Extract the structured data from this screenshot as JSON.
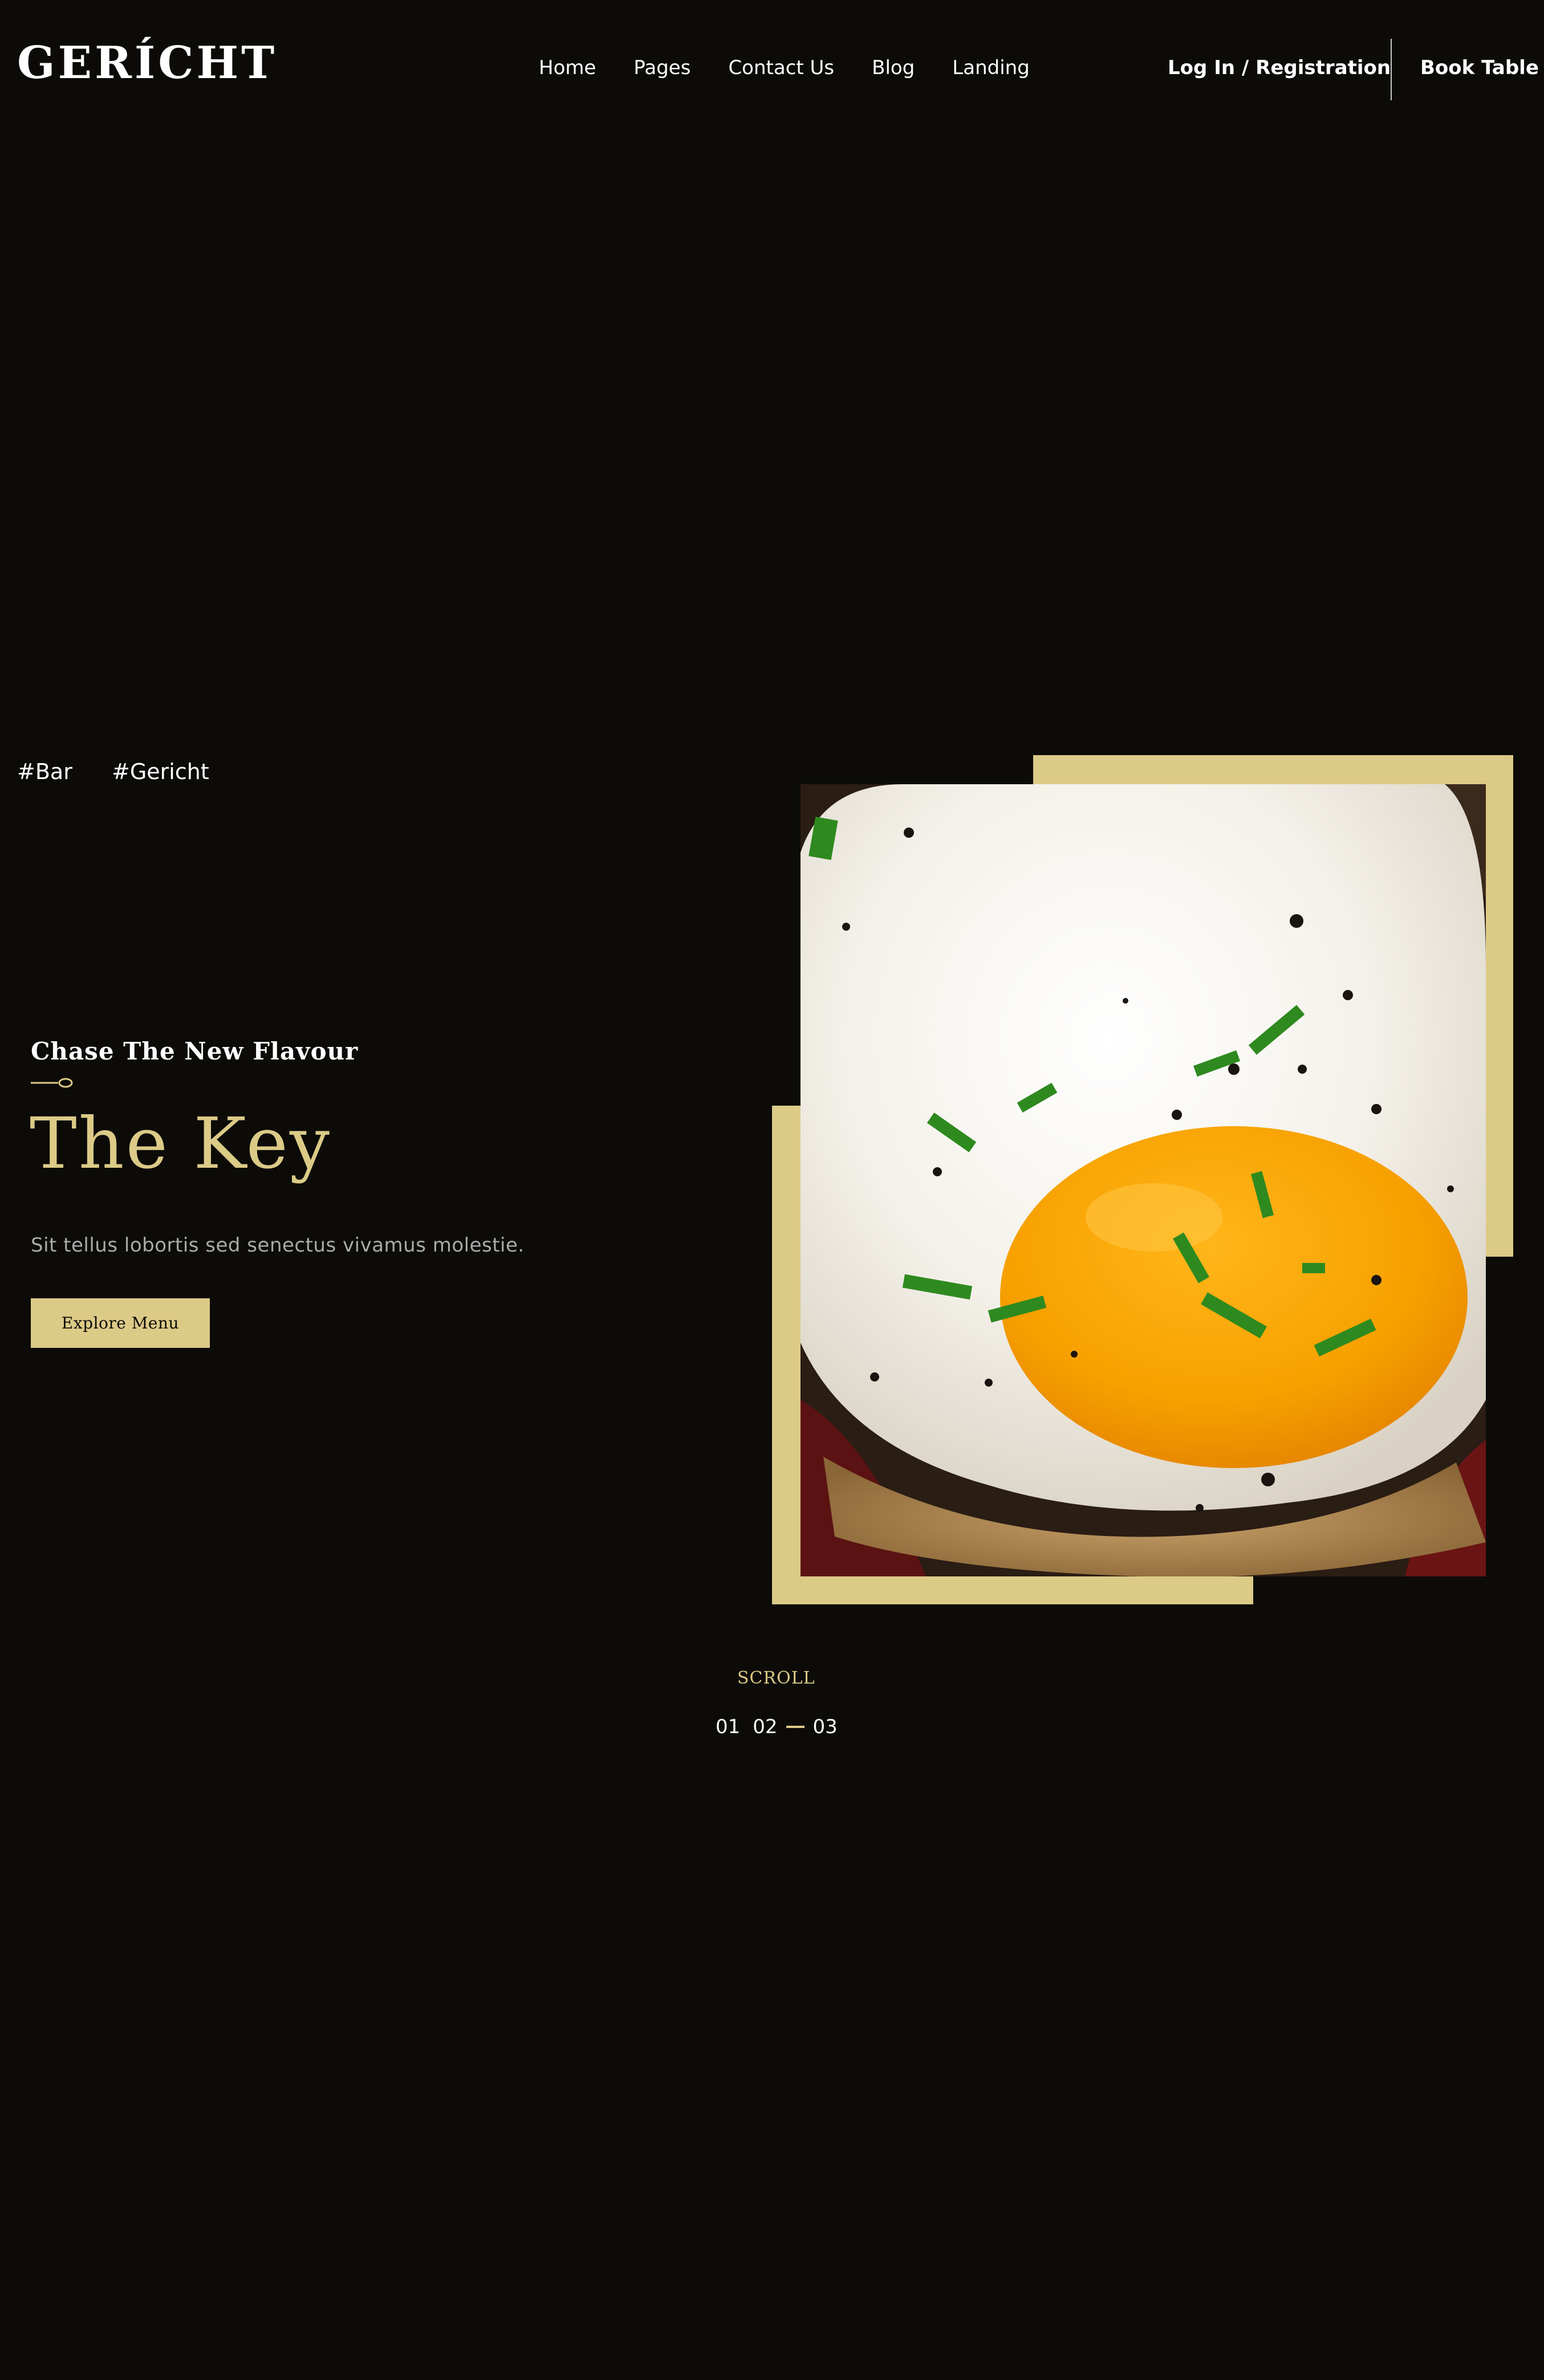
{
  "brand": {
    "logo_text": "GERÍCHT"
  },
  "nav": {
    "links": [
      "Home",
      "Pages",
      "Contact Us",
      "Blog",
      "Landing"
    ],
    "login_label": "Log In / Registration",
    "book_label": "Book Table"
  },
  "tags": [
    "#Bar",
    "#Gericht"
  ],
  "hero": {
    "subtitle": "Chase The New Flavour",
    "title": "The Key",
    "description": "Sit tellus lobortis sed senectus vivamus molestie.",
    "button_label": "Explore Menu",
    "image_alt": "fried-egg-on-toast"
  },
  "scroll": {
    "label": "SCROLL",
    "pages": [
      "01",
      "02",
      "03"
    ]
  },
  "colors": {
    "background": "#0c0b08",
    "accent": "#dcca87",
    "muted_text": "#aaaaaa",
    "text": "#ffffff"
  },
  "icons": [
    "spoon-icon"
  ]
}
